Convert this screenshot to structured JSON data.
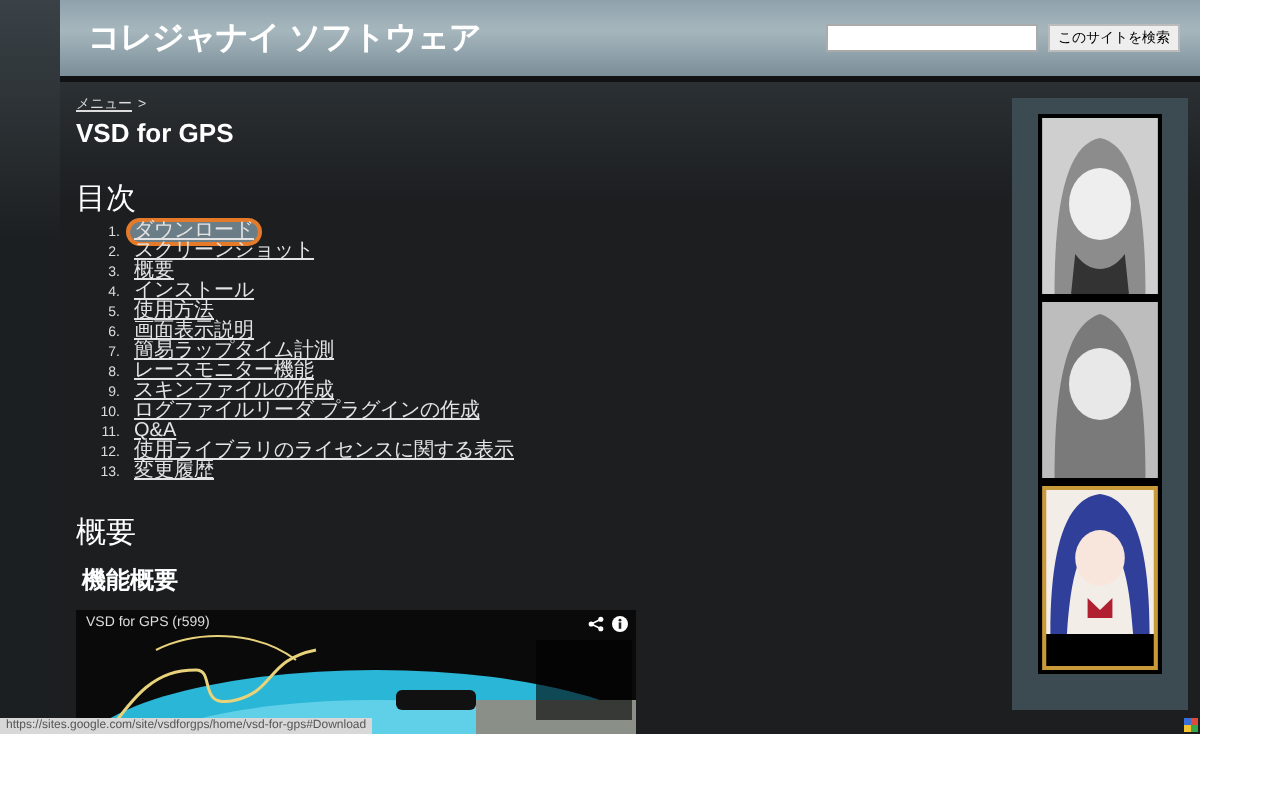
{
  "header": {
    "site_title": "コレジャナイ ソフトウェア",
    "search_button": "このサイトを検索"
  },
  "breadcrumb": {
    "link": "メニュー",
    "separator": ">"
  },
  "page_title": "VSD for GPS",
  "toc": {
    "heading": "目次",
    "items": [
      {
        "number": "1.",
        "label": "ダウンロード",
        "circled": true
      },
      {
        "number": "2.",
        "label": "スクリーンショット",
        "circled": false
      },
      {
        "number": "3.",
        "label": "概要",
        "circled": false
      },
      {
        "number": "4.",
        "label": "インストール",
        "circled": false
      },
      {
        "number": "5.",
        "label": "使用方法",
        "circled": false
      },
      {
        "number": "6.",
        "label": "画面表示説明",
        "circled": false
      },
      {
        "number": "7.",
        "label": "簡易ラップタイム計測",
        "circled": false
      },
      {
        "number": "8.",
        "label": "レースモニター機能",
        "circled": false
      },
      {
        "number": "9.",
        "label": "スキンファイルの作成",
        "circled": false
      },
      {
        "number": "10.",
        "label": "ログファイルリーダ プラグインの作成",
        "circled": false
      },
      {
        "number": "11.",
        "label": "Q&A",
        "circled": false
      },
      {
        "number": "12.",
        "label": "使用ライブラリのライセンスに関する表示",
        "circled": false
      },
      {
        "number": "13.",
        "label": "変更履歴",
        "circled": false
      }
    ]
  },
  "section": {
    "heading": "概要",
    "subheading": "機能概要"
  },
  "video": {
    "title": "VSD for GPS (r599)"
  },
  "status_bar": {
    "url": "https://sites.google.com/site/vsdforgps/home/vsd-for-gps#Download"
  }
}
